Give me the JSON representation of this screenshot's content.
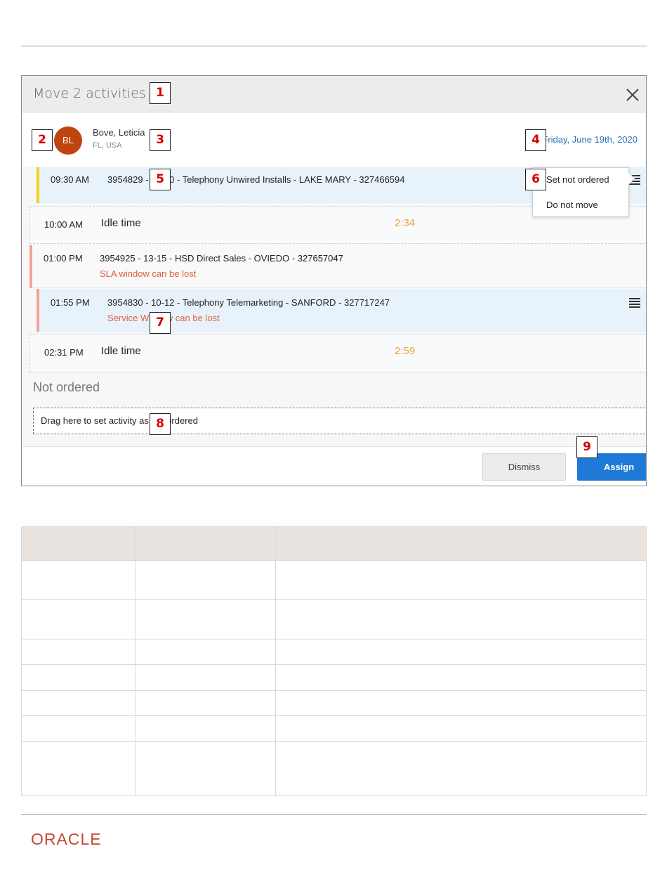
{
  "dialog": {
    "title": "Move 2 activities",
    "close_icon": "close-icon"
  },
  "resource": {
    "initials": "BL",
    "name": "Bove, Leticia",
    "location": "FL, USA",
    "date": "Friday, June 19th, 2020",
    "avatar_color": "#c0440f"
  },
  "activities": [
    {
      "time": "09:30 AM",
      "title": "3954829 - 10-10 - Telephony Unwired Installs - LAKE MARY - 327466594",
      "warning": "",
      "status_color": "#f1d11a"
    },
    {
      "time": "01:00 PM",
      "title": "3954925 - 13-15 - HSD Direct Sales - OVIEDO - 327657047",
      "warning": "SLA window can be lost",
      "status_color": "#f0a29a"
    },
    {
      "time": "01:55 PM",
      "title": "3954830 - 10-12 - Telephony Telemarketing - SANFORD - 327717247",
      "warning": "Service Window can be lost",
      "status_color": "#f0a29a"
    }
  ],
  "idle": [
    {
      "time": "10:00 AM",
      "label": "Idle time",
      "duration": "2:34"
    },
    {
      "time": "02:31 PM",
      "label": "Idle time",
      "duration": "2:59"
    }
  ],
  "popup_menu": {
    "items": [
      "Set not ordered",
      "Do not move"
    ]
  },
  "not_ordered": {
    "title": "Not ordered",
    "drop_text": "Drag here to set activity as not ordered"
  },
  "footer": {
    "dismiss_label": "Dismiss",
    "assign_label": "Assign"
  },
  "callouts": [
    "1",
    "2",
    "3",
    "4",
    "5",
    "6",
    "7",
    "8",
    "9"
  ],
  "brand": {
    "logo_text": "ORACLE",
    "logo_color": "#c74634"
  }
}
